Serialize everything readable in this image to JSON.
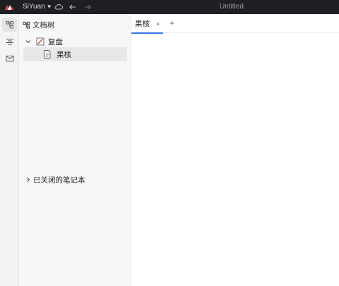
{
  "titlebar": {
    "app_name": "SiYuan",
    "window_title": "Untitled",
    "icons": [
      "siyuan-logo",
      "chevron-down-icon",
      "cloud-icon",
      "back-arrow-icon",
      "forward-arrow-icon"
    ],
    "background": "#1f1f23"
  },
  "dock": {
    "items": [
      "file-tree-icon",
      "outline-icon",
      "inbox-icon"
    ]
  },
  "tree": {
    "title": "文档树",
    "notebook": {
      "name": "复盘",
      "expanded": true
    },
    "documents": [
      {
        "name": "果核",
        "selected": true
      }
    ],
    "closed_notebooks_label": "已关闭的笔记本"
  },
  "editor": {
    "tabs": [
      {
        "label": "果核",
        "active": true
      }
    ],
    "add_tab_symbol": "+",
    "close_symbol": "×",
    "accent": "#3575f0"
  }
}
